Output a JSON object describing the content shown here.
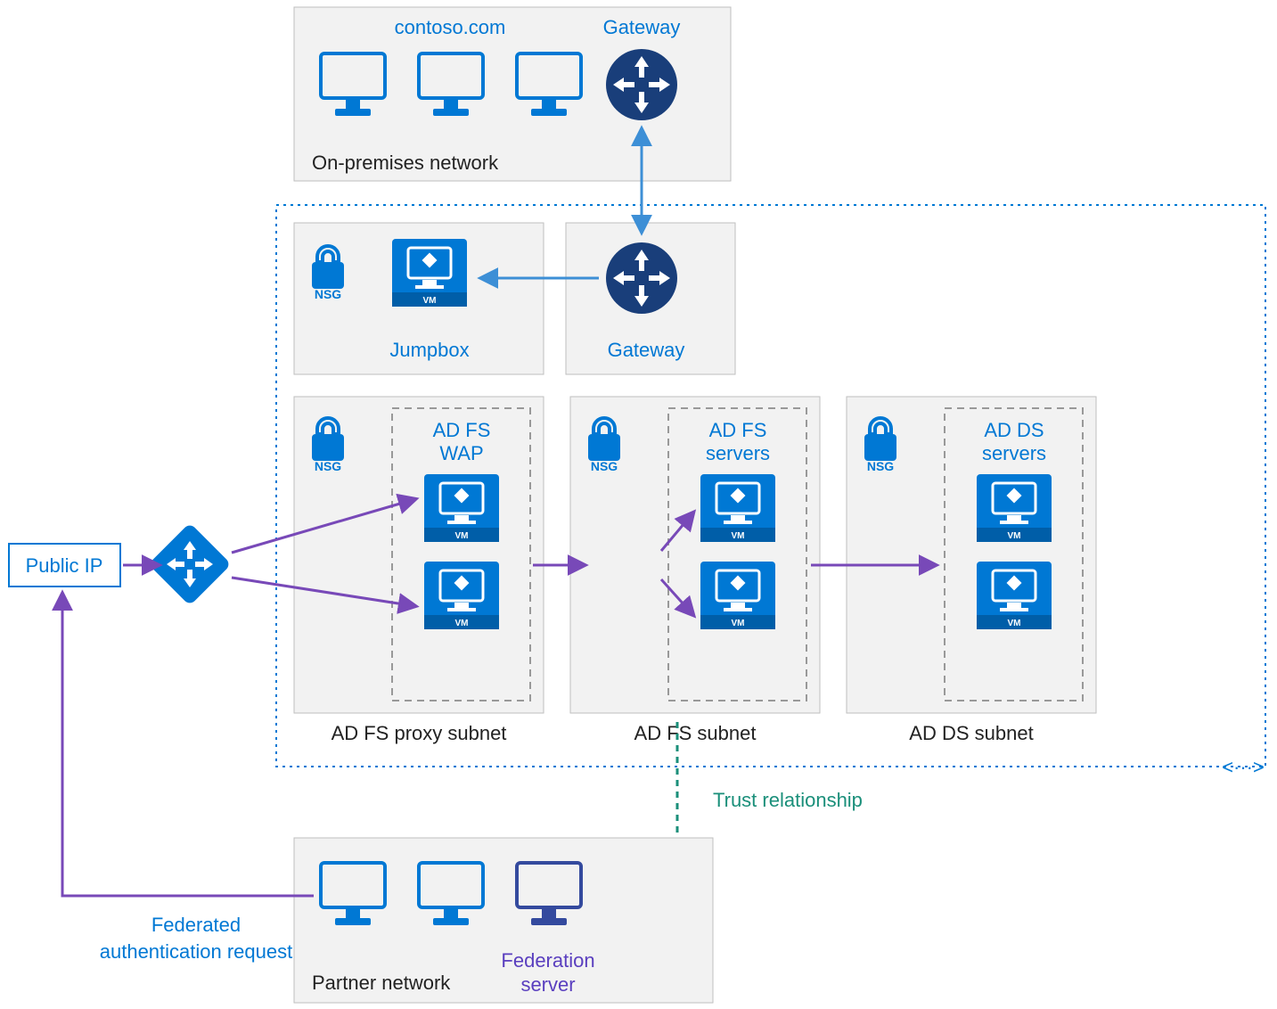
{
  "onprem": {
    "title": "contoso.com",
    "gateway": "Gateway",
    "caption": "On-premises network"
  },
  "jumpbox": {
    "nsg": "NSG",
    "label": "Jumpbox",
    "gateway": "Gateway"
  },
  "public_ip": "Public IP",
  "wap": {
    "nsg": "NSG",
    "title1": "AD FS",
    "title2": "WAP",
    "vm": "VM",
    "caption": "AD FS proxy subnet"
  },
  "adfs": {
    "nsg": "NSG",
    "title1": "AD FS",
    "title2": "servers",
    "vm": "VM",
    "caption": "AD FS subnet"
  },
  "adds": {
    "nsg": "NSG",
    "title1": "AD DS",
    "title2": "servers",
    "vm": "VM",
    "caption": "AD DS subnet"
  },
  "trust": "Trust relationship",
  "federated1": "Federated",
  "federated2": "authentication request",
  "partner": {
    "caption": "Partner network",
    "fed1": "Federation",
    "fed2": "server"
  },
  "vnet_expand": "<···>"
}
